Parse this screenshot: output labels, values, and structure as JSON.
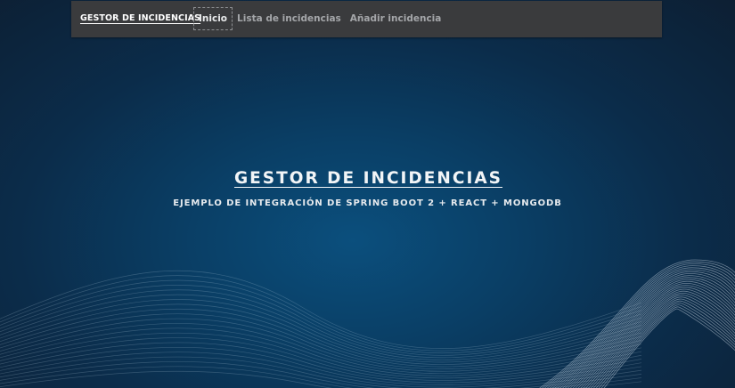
{
  "navbar": {
    "brand": "GESTOR DE INCIDENCIAS",
    "links": [
      {
        "label": "Inicio",
        "active": true
      },
      {
        "label": "Lista de incidencias",
        "active": false
      },
      {
        "label": "Añadir incidencia",
        "active": false
      }
    ]
  },
  "hero": {
    "title": "GESTOR DE INCIDENCIAS",
    "subtitle": "EJEMPLO DE INTEGRACIÓN DE SPRING BOOT 2 + REACT + MONGODB"
  },
  "colors": {
    "navbar_bg": "#3a3b3d",
    "background": "#0b3f66",
    "text": "#ffffff"
  }
}
